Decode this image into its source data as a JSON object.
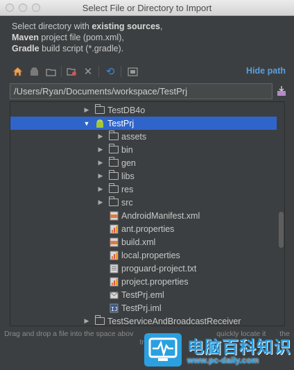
{
  "window": {
    "title": "Select File or Directory to Import"
  },
  "description": {
    "line1_pre": "Select directory with ",
    "line1_bold": "existing sources",
    "line1_post": ",",
    "line2_bold": "Maven",
    "line2_post": " project file (pom.xml),",
    "line3_bold": "Gradle",
    "line3_post": " build script (*.gradle)."
  },
  "toolbar": {
    "icons": [
      "home-icon",
      "android-icon",
      "project-folder-icon",
      "new-folder-icon",
      "delete-icon",
      "refresh-icon",
      "show-hidden-icon"
    ],
    "hide_path_label": "Hide path"
  },
  "path": {
    "value": "/Users/Ryan/Documents/workspace/TestPrj"
  },
  "tree": {
    "rows": [
      {
        "label": "TestDB4o",
        "type": "folder",
        "expanded": false
      },
      {
        "label": "TestPrj",
        "type": "android-project",
        "expanded": true,
        "selected": true
      },
      {
        "label": "assets",
        "type": "folder",
        "expanded": false
      },
      {
        "label": "bin",
        "type": "folder",
        "expanded": false
      },
      {
        "label": "gen",
        "type": "folder",
        "expanded": false
      },
      {
        "label": "libs",
        "type": "folder",
        "expanded": false
      },
      {
        "label": "res",
        "type": "folder",
        "expanded": false
      },
      {
        "label": "src",
        "type": "folder",
        "expanded": false
      },
      {
        "label": "AndroidManifest.xml",
        "type": "xml-file"
      },
      {
        "label": "ant.properties",
        "type": "properties-file"
      },
      {
        "label": "build.xml",
        "type": "xml-file"
      },
      {
        "label": "local.properties",
        "type": "properties-file"
      },
      {
        "label": "proguard-project.txt",
        "type": "text-file"
      },
      {
        "label": "project.properties",
        "type": "properties-file"
      },
      {
        "label": "TestPrj.eml",
        "type": "eml-file"
      },
      {
        "label": "TestPrj.iml",
        "type": "iml-file"
      },
      {
        "label": "TestServiceAndBroadcastReceiver",
        "type": "folder",
        "expanded": false
      }
    ]
  },
  "hint": {
    "pre": "Drag and drop a file into the space abov",
    "post": "quickly locate it",
    "end": "the tree."
  },
  "watermark": {
    "title": "电脑百科知识",
    "url": "www.pc-daily.com"
  },
  "colors": {
    "background": "#3c3f41",
    "selection": "#2f65ca",
    "link": "#5a9fe0",
    "watermark": "#2a9bdd"
  }
}
